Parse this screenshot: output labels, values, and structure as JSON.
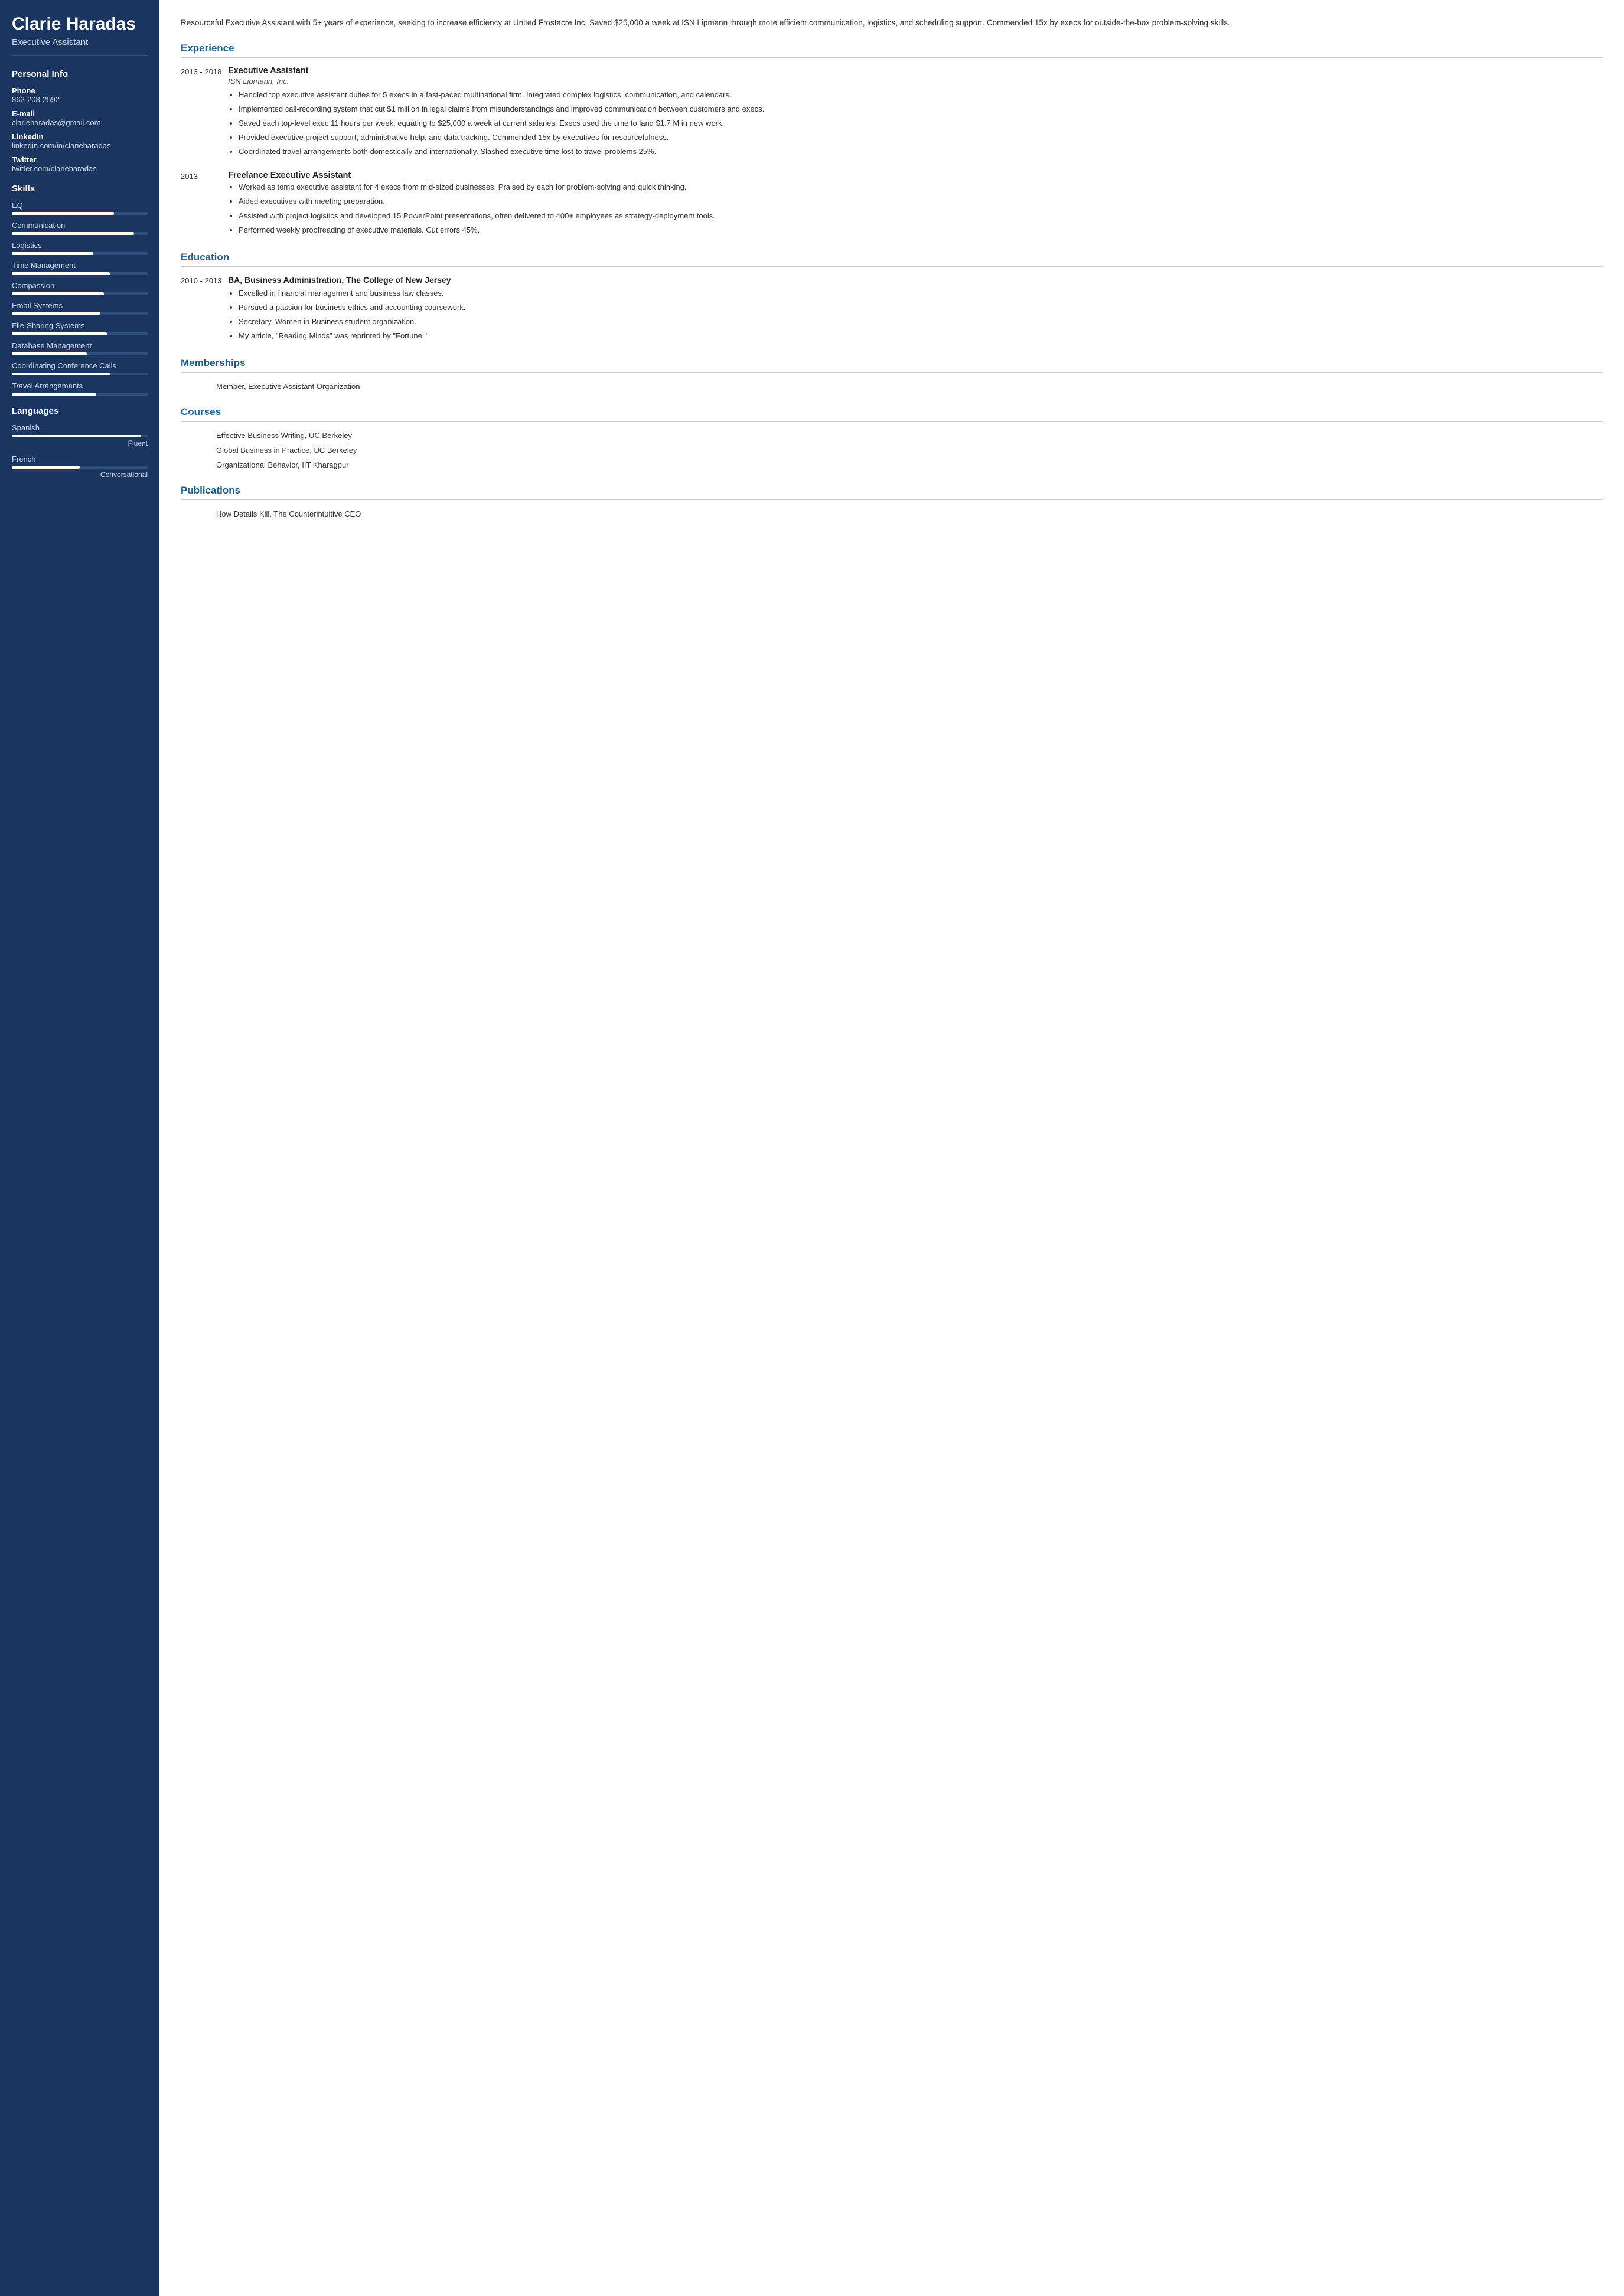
{
  "sidebar": {
    "name": "Clarie Haradas",
    "title": "Executive Assistant",
    "personal_info": {
      "section_title": "Personal Info",
      "phone_label": "Phone",
      "phone_value": "862-208-2592",
      "email_label": "E-mail",
      "email_value": "clarieharadas@gmail.com",
      "linkedin_label": "LinkedIn",
      "linkedin_value": "linkedin.com/in/clarieharadas",
      "twitter_label": "Twitter",
      "twitter_value": "twitter.com/clarieharadas"
    },
    "skills": {
      "section_title": "Skills",
      "items": [
        {
          "label": "EQ",
          "pct": 75
        },
        {
          "label": "Communication",
          "pct": 90
        },
        {
          "label": "Logistics",
          "pct": 60
        },
        {
          "label": "Time Management",
          "pct": 72
        },
        {
          "label": "Compassion",
          "pct": 68
        },
        {
          "label": "Email Systems",
          "pct": 65
        },
        {
          "label": "File-Sharing Systems",
          "pct": 70
        },
        {
          "label": "Database Management",
          "pct": 55
        },
        {
          "label": "Coordinating Conference Calls",
          "pct": 72
        },
        {
          "label": "Travel Arrangements",
          "pct": 62
        }
      ]
    },
    "languages": {
      "section_title": "Languages",
      "items": [
        {
          "name": "Spanish",
          "pct": 95,
          "level": "Fluent"
        },
        {
          "name": "French",
          "pct": 50,
          "level": "Conversational"
        }
      ]
    }
  },
  "main": {
    "summary": "Resourceful Executive Assistant with 5+ years of experience, seeking to increase efficiency at United Frostacre Inc. Saved $25,000 a week at ISN Lipmann through more efficient communication, logistics, and scheduling support. Commended 15x by execs for outside-the-box problem-solving skills.",
    "experience": {
      "title": "Experience",
      "entries": [
        {
          "dates": "2013 - 2018",
          "job_title": "Executive Assistant",
          "company": "ISN Lipmann, Inc.",
          "bullets": [
            "Handled top executive assistant duties for 5 execs in a fast-paced multinational firm. Integrated complex logistics, communication, and calendars.",
            "Implemented call-recording system that cut $1 million in legal claims from misunderstandings and improved communication between customers and execs.",
            "Saved each top-level exec 11 hours per week, equating to $25,000 a week at current salaries. Execs used the time to land $1.7 M in new work.",
            "Provided executive project support, administrative help, and data tracking. Commended 15x by executives for resourcefulness.",
            "Coordinated travel arrangements both domestically and internationally. Slashed executive time lost to travel problems 25%."
          ]
        },
        {
          "dates": "2013",
          "job_title": "Freelance Executive Assistant",
          "company": "",
          "bullets": [
            "Worked as temp executive assistant for 4 execs from mid-sized businesses. Praised by each for problem-solving and quick thinking.",
            "Aided executives with meeting preparation.",
            "Assisted with project logistics and developed 15 PowerPoint presentations, often delivered to 400+ employees as strategy-deployment tools.",
            "Performed weekly proofreading of executive materials. Cut errors 45%."
          ]
        }
      ]
    },
    "education": {
      "title": "Education",
      "entries": [
        {
          "dates": "2010 - 2013",
          "degree": "BA, Business Administration, The College of New Jersey",
          "bullets": [
            "Excelled in financial management and business law classes.",
            "Pursued a passion for business ethics and accounting coursework.",
            "Secretary, Women in Business student organization.",
            "My article, \"Reading Minds\" was reprinted by \"Fortune.\""
          ]
        }
      ]
    },
    "memberships": {
      "title": "Memberships",
      "items": [
        "Member, Executive Assistant Organization"
      ]
    },
    "courses": {
      "title": "Courses",
      "items": [
        "Effective Business Writing, UC Berkeley",
        "Global Business in Practice, UC Berkeley",
        "Organizational Behavior, IIT Kharagpur"
      ]
    },
    "publications": {
      "title": "Publications",
      "items": [
        "How Details Kill, The Counterintuitive CEO"
      ]
    }
  }
}
